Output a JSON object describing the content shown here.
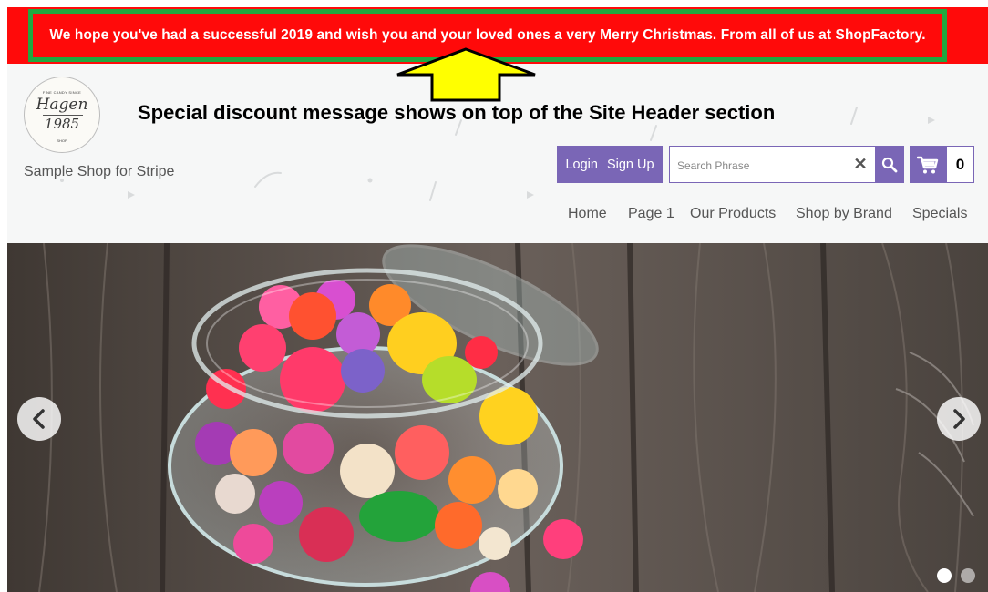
{
  "announcement": {
    "text": "We hope you've had a successful 2019 and wish you and your loved ones a very Merry Christmas. From all of us at ShopFactory."
  },
  "annotation": {
    "caption": "Special discount message shows on top of the Site Header section",
    "arrow_icon": "up-arrow-icon",
    "arrow_color": "#ffff00",
    "highlight_color": "#21a83f"
  },
  "header": {
    "logo": {
      "top_text": "FINE CANDY SINCE",
      "name": "Hagen",
      "year": "1985",
      "bottom_text": "SHOP"
    },
    "shop_name": "Sample Shop for Stripe",
    "account": {
      "login_label": "Login",
      "signup_label": "Sign Up"
    },
    "search": {
      "placeholder": "Search Phrase",
      "value": ""
    },
    "cart": {
      "count": "0"
    },
    "accent_color": "#7a66b6"
  },
  "nav": {
    "items": [
      {
        "label": "Home"
      },
      {
        "label": "Page 1"
      },
      {
        "label": "Our Products"
      },
      {
        "label": "Shop by Brand"
      },
      {
        "label": "Specials"
      }
    ]
  },
  "hero": {
    "prev_icon": "chevron-left-icon",
    "next_icon": "chevron-right-icon",
    "slide_count": 2,
    "active_slide": 1
  }
}
